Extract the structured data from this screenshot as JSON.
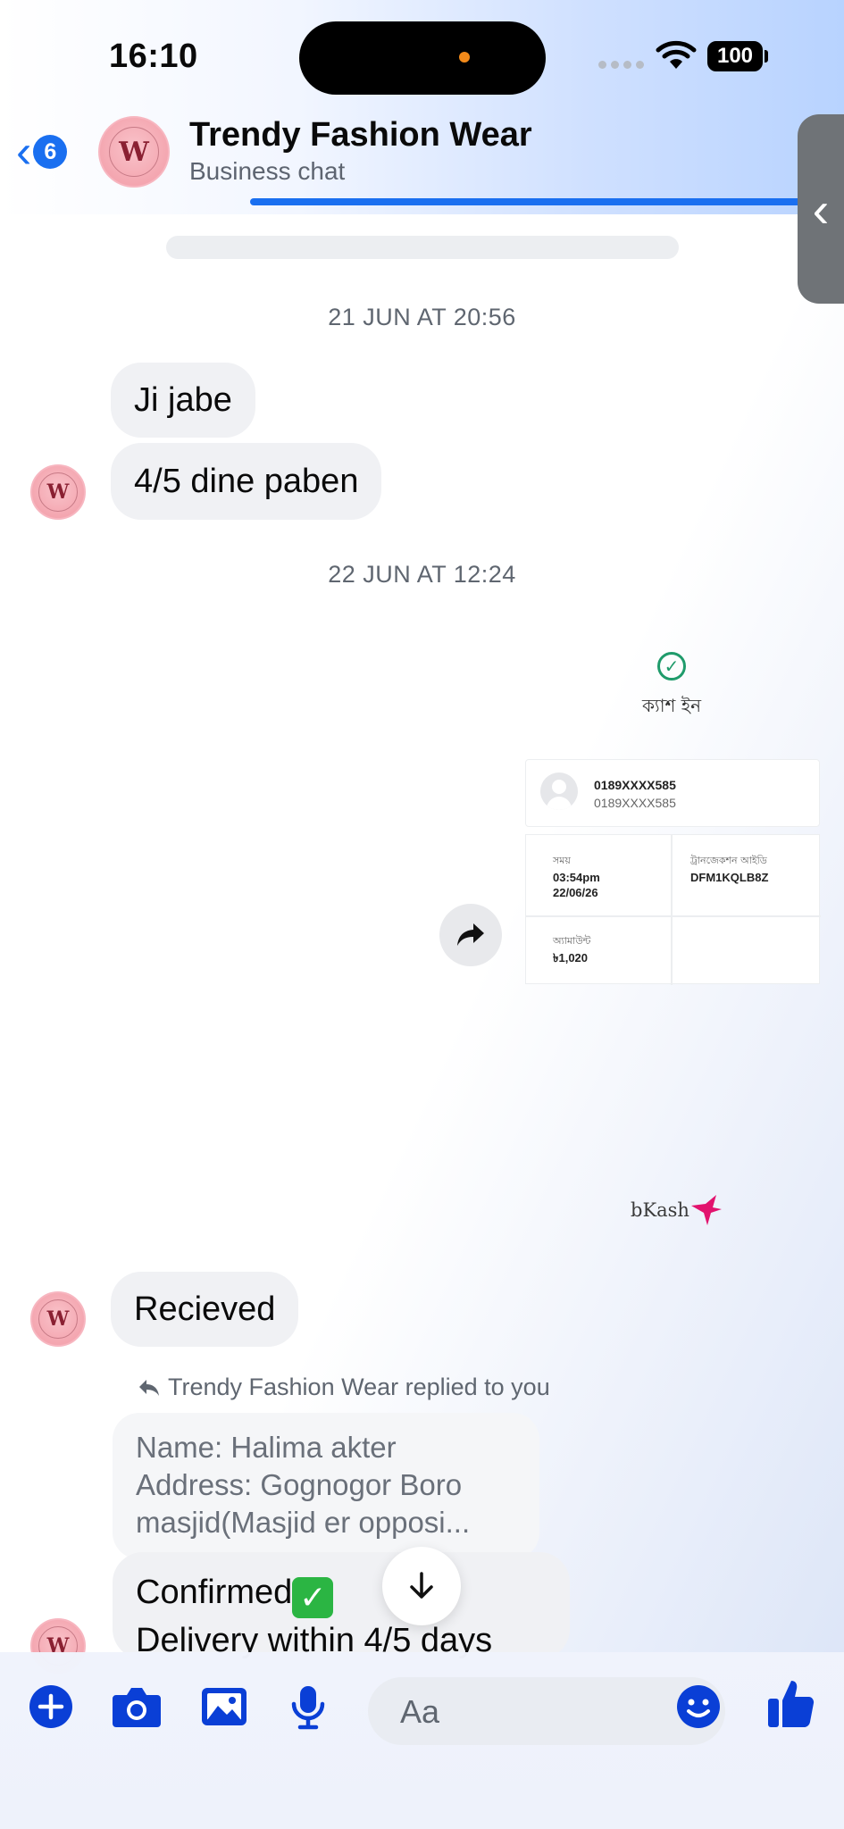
{
  "status_bar": {
    "time": "16:10",
    "battery": "100"
  },
  "header": {
    "back_count": "6",
    "avatar_letter": "W",
    "title": "Trendy Fashion Wear",
    "subtitle": "Business chat"
  },
  "messages": {
    "timestamp_1": "21 JUN AT 20:56",
    "bubble_1": "Ji jabe",
    "bubble_2": "4/5 dine paben",
    "timestamp_2": "22 JUN AT 12:24",
    "receipt": {
      "status": "ক্যাশ ইন",
      "account_primary": "0189XXXX585",
      "account_secondary": "0189XXXX585",
      "time_label": "সময়",
      "time_value": "03:54pm",
      "date_value": "22/06/26",
      "trx_label": "ট্রানজেকশন আইডি",
      "trx_value": "DFM1KQLB8Z",
      "amount_label": "অ্যামাউন্ট",
      "amount_value": "৳1,020",
      "brand": "bKash"
    },
    "bubble_3": "Recieved",
    "reply_note": "Trendy Fashion Wear replied to you",
    "quoted_lines": [
      "Name: Halima akter",
      "Address: Gognogor Boro",
      "masjid(Masjid er opposi..."
    ],
    "confirm_line_1": "Confirmed",
    "confirm_line_2": "Delivery within 4/5 days"
  },
  "composer": {
    "placeholder": "Aa"
  },
  "colors": {
    "accent": "#1a6ff0",
    "composer_icon": "#0a3fd6",
    "bubble": "#f0f1f4",
    "avatar": "#f4a6b0"
  }
}
